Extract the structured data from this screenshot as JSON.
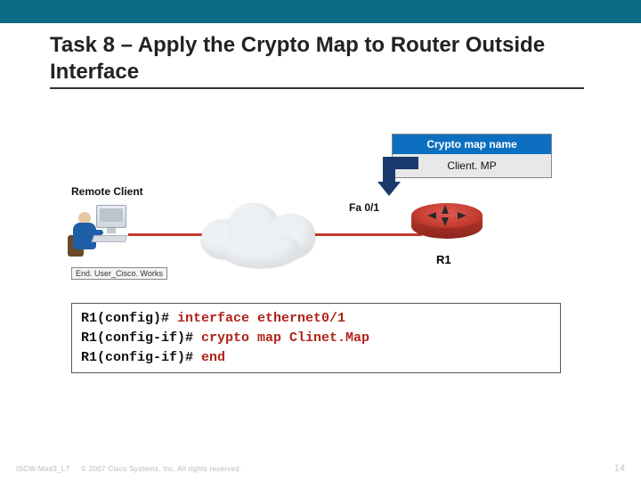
{
  "header": {
    "title": "Task 8 – Apply the Crypto Map to Router Outside Interface"
  },
  "diagram": {
    "cryptoMap": {
      "header": "Crypto map name",
      "value": "Client. MP"
    },
    "remoteClientLabel": "Remote Client",
    "endUserTag": "End. User_Cisco. Works",
    "interfaceLabel": "Fa 0/1",
    "routerLabel": "R1"
  },
  "code": {
    "lines": [
      {
        "prompt": "R1(config)# ",
        "command": "interface ethernet0/1"
      },
      {
        "prompt": "R1(config-if)# ",
        "command": "crypto map Clinet.Map"
      },
      {
        "prompt": "R1(config-if)# ",
        "command": "end"
      }
    ]
  },
  "footer": {
    "left": "ISCW-Mod3_L7",
    "copyright": "© 2007 Cisco Systems, Inc. All rights reserved.",
    "page": "14"
  }
}
